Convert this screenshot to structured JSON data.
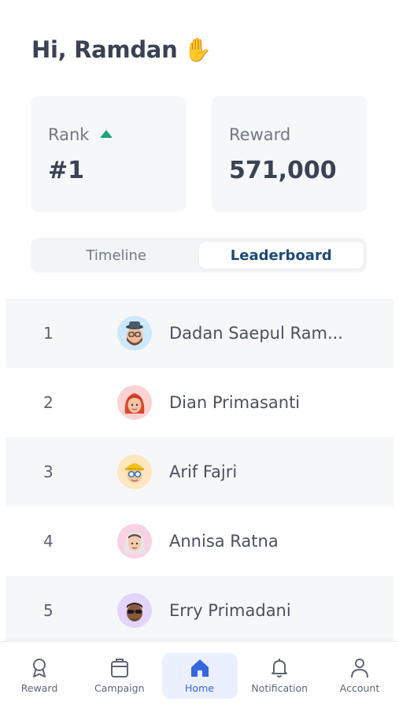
{
  "header": {
    "greeting": "Hi, Ramdan",
    "wave_emoji": "✋"
  },
  "stats": {
    "rank": {
      "label": "Rank",
      "value": "#1",
      "trend": "up",
      "trend_color": "#1fa37a"
    },
    "reward": {
      "label": "Reward",
      "value": "571,000"
    }
  },
  "tabs": [
    {
      "label": "Timeline",
      "active": false
    },
    {
      "label": "Leaderboard",
      "active": true
    }
  ],
  "leaderboard": [
    {
      "rank": "1",
      "name": "Dadan Saepul Ram...",
      "avatar": "avatar-hat-beard",
      "avatar_bg": "#cde8fb"
    },
    {
      "rank": "2",
      "name": "Dian Primasanti",
      "avatar": "avatar-red-hair",
      "avatar_bg": "#fbd3d3"
    },
    {
      "rank": "3",
      "name": "Arif Fajri",
      "avatar": "avatar-hardhat-glasses",
      "avatar_bg": "#fde6c0"
    },
    {
      "rank": "4",
      "name": "Annisa Ratna",
      "avatar": "avatar-hijab",
      "avatar_bg": "#f9d1e4"
    },
    {
      "rank": "5",
      "name": "Erry Primadani",
      "avatar": "avatar-sunglasses",
      "avatar_bg": "#e3d4fb"
    }
  ],
  "nav": [
    {
      "label": "Reward",
      "icon": "award-icon",
      "active": false
    },
    {
      "label": "Campaign",
      "icon": "briefcase-icon",
      "active": false
    },
    {
      "label": "Home",
      "icon": "home-icon",
      "active": true
    },
    {
      "label": "Notification",
      "icon": "bell-icon",
      "active": false
    },
    {
      "label": "Account",
      "icon": "user-icon",
      "active": false
    }
  ],
  "colors": {
    "accent": "#3566e0",
    "tab_active": "#1c4a79",
    "text": "#3a4254"
  }
}
